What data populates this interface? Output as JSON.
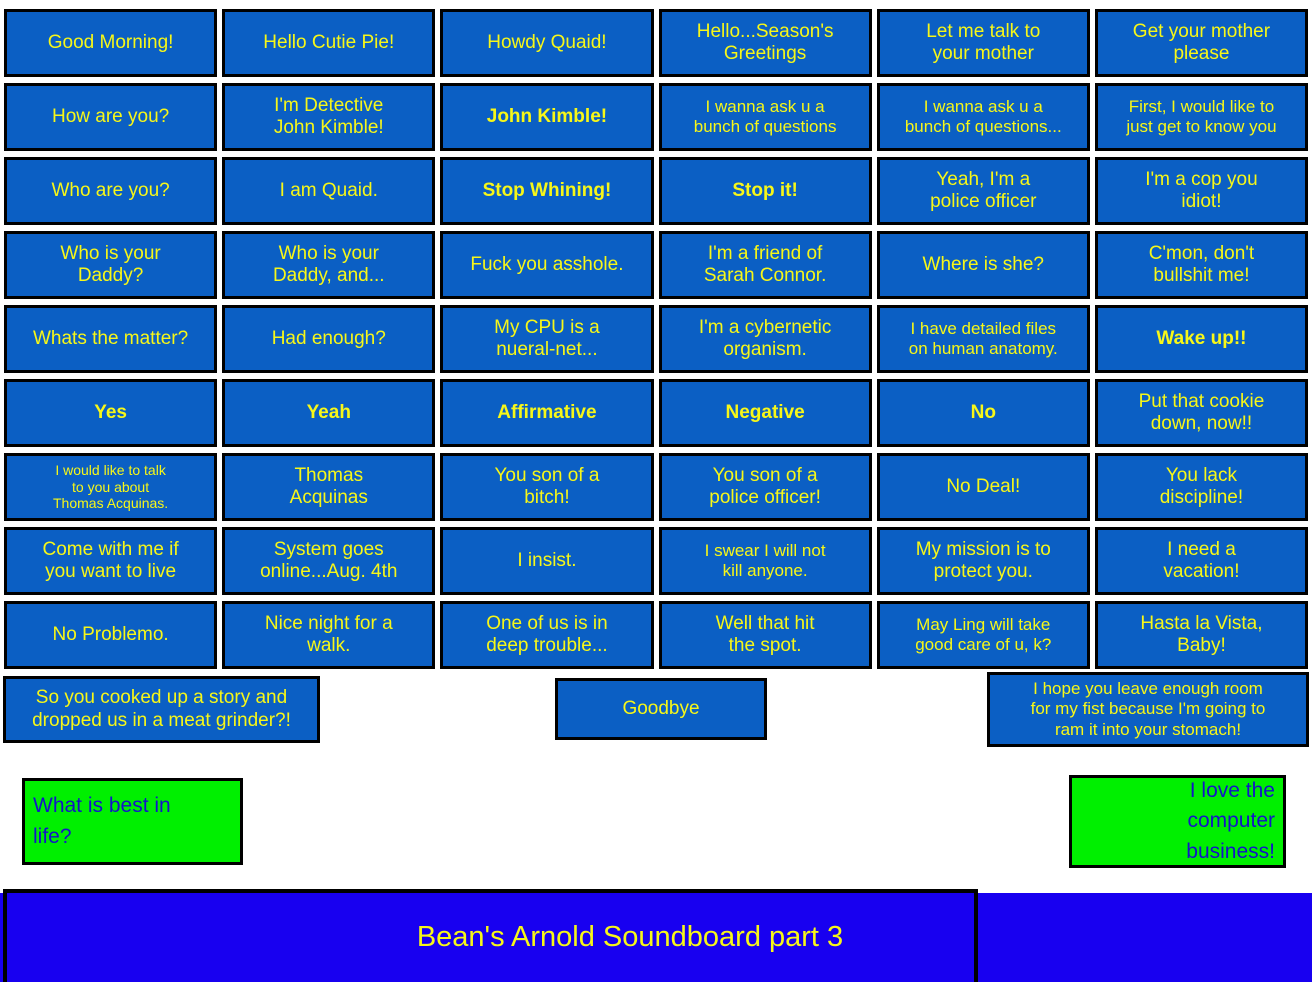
{
  "page": {
    "title": "Bean's Arnold Soundboard part 3",
    "colors": {
      "button_blue": "#0B5FC4",
      "button_text_yellow": "#F7F718",
      "button_green": "#00F000",
      "green_text_blue": "#1414C8",
      "footer_blue": "#1800F0",
      "border_black": "#000000",
      "background_white": "#FFFFFF"
    }
  },
  "grid": {
    "rows": [
      [
        {
          "label": "Good Morning!",
          "bold": false,
          "size": "lg"
        },
        {
          "label": "Hello Cutie Pie!",
          "bold": false,
          "size": "lg"
        },
        {
          "label": "Howdy Quaid!",
          "bold": false,
          "size": "lg"
        },
        {
          "label": "Hello...Season's\nGreetings",
          "bold": false,
          "size": "lg"
        },
        {
          "label": "Let me talk to\nyour mother",
          "bold": false,
          "size": "lg"
        },
        {
          "label": "Get your mother\nplease",
          "bold": false,
          "size": "lg"
        }
      ],
      [
        {
          "label": "How are you?",
          "bold": false,
          "size": "lg"
        },
        {
          "label": "I'm Detective\nJohn Kimble!",
          "bold": false,
          "size": "lg"
        },
        {
          "label": "John Kimble!",
          "bold": true,
          "size": "lg"
        },
        {
          "label": "I wanna ask u a\nbunch of questions",
          "bold": false,
          "size": "md"
        },
        {
          "label": "I wanna ask u a\nbunch of questions...",
          "bold": false,
          "size": "md"
        },
        {
          "label": "First, I would like to\njust get to know you",
          "bold": false,
          "size": "md"
        }
      ],
      [
        {
          "label": "Who are you?",
          "bold": false,
          "size": "lg"
        },
        {
          "label": "I am Quaid.",
          "bold": false,
          "size": "lg"
        },
        {
          "label": "Stop Whining!",
          "bold": true,
          "size": "lg"
        },
        {
          "label": "Stop it!",
          "bold": true,
          "size": "lg"
        },
        {
          "label": "Yeah, I'm a\npolice officer",
          "bold": false,
          "size": "lg"
        },
        {
          "label": "I'm a cop you\nidiot!",
          "bold": false,
          "size": "lg"
        }
      ],
      [
        {
          "label": "Who is your\nDaddy?",
          "bold": false,
          "size": "lg"
        },
        {
          "label": "Who is your\nDaddy, and...",
          "bold": false,
          "size": "lg"
        },
        {
          "label": "Fuck you asshole.",
          "bold": false,
          "size": "lg"
        },
        {
          "label": "I'm a friend of\nSarah Connor.",
          "bold": false,
          "size": "lg"
        },
        {
          "label": "Where is she?",
          "bold": false,
          "size": "lg"
        },
        {
          "label": "C'mon, don't\nbullshit me!",
          "bold": false,
          "size": "lg"
        }
      ],
      [
        {
          "label": "Whats the matter?",
          "bold": false,
          "size": "lg"
        },
        {
          "label": "Had enough?",
          "bold": false,
          "size": "lg"
        },
        {
          "label": "My CPU is a\nnueral-net...",
          "bold": false,
          "size": "lg"
        },
        {
          "label": "I'm a cybernetic\norganism.",
          "bold": false,
          "size": "lg"
        },
        {
          "label": "I have detailed files\non human anatomy.",
          "bold": false,
          "size": "md"
        },
        {
          "label": "Wake up!!",
          "bold": true,
          "size": "lg"
        }
      ],
      [
        {
          "label": "Yes",
          "bold": true,
          "size": "lg"
        },
        {
          "label": "Yeah",
          "bold": true,
          "size": "lg"
        },
        {
          "label": "Affirmative",
          "bold": true,
          "size": "lg"
        },
        {
          "label": "Negative",
          "bold": true,
          "size": "lg"
        },
        {
          "label": "No",
          "bold": true,
          "size": "lg"
        },
        {
          "label": "Put that cookie\ndown, now!!",
          "bold": false,
          "size": "lg"
        }
      ],
      [
        {
          "label": "I would like to talk\nto you about\nThomas Acquinas.",
          "bold": false,
          "size": "sm"
        },
        {
          "label": "Thomas\nAcquinas",
          "bold": false,
          "size": "lg"
        },
        {
          "label": "You son of a\nbitch!",
          "bold": false,
          "size": "lg"
        },
        {
          "label": "You son of a\npolice officer!",
          "bold": false,
          "size": "lg"
        },
        {
          "label": "No Deal!",
          "bold": false,
          "size": "lg"
        },
        {
          "label": "You lack\ndiscipline!",
          "bold": false,
          "size": "lg"
        }
      ],
      [
        {
          "label": "Come with me if\nyou want to live",
          "bold": false,
          "size": "lg"
        },
        {
          "label": "System goes\nonline...Aug. 4th",
          "bold": false,
          "size": "lg"
        },
        {
          "label": "I insist.",
          "bold": false,
          "size": "lg"
        },
        {
          "label": "I swear I will not\nkill anyone.",
          "bold": false,
          "size": "md"
        },
        {
          "label": "My mission is to\nprotect you.",
          "bold": false,
          "size": "lg"
        },
        {
          "label": "I need a\nvacation!",
          "bold": false,
          "size": "lg"
        }
      ],
      [
        {
          "label": "No Problemo.",
          "bold": false,
          "size": "lg"
        },
        {
          "label": "Nice night for a\nwalk.",
          "bold": false,
          "size": "lg"
        },
        {
          "label": "One of us is in\ndeep trouble...",
          "bold": false,
          "size": "lg"
        },
        {
          "label": "Well that hit\nthe spot.",
          "bold": false,
          "size": "lg"
        },
        {
          "label": "May Ling will take\ngood care of u, k?",
          "bold": false,
          "size": "md"
        },
        {
          "label": "Hasta la Vista,\nBaby!",
          "bold": false,
          "size": "lg"
        }
      ]
    ]
  },
  "extras": {
    "meat_grinder": "So you cooked up a story and\ndropped us in a meat grinder?!",
    "goodbye": "Goodbye",
    "fist": "I hope you leave enough room\nfor my fist because I'm going to\nram it into your stomach!",
    "best_in_life": "What is best in\nlife?",
    "computer_business": "I love the\ncomputer\nbusiness!"
  },
  "footer": {
    "title": "Bean's Arnold Soundboard part 3"
  }
}
